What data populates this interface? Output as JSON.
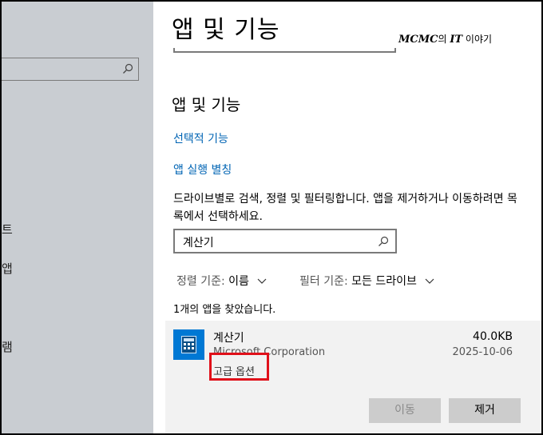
{
  "sidebar": {
    "partial_chars": [
      "트",
      "앱",
      "램"
    ]
  },
  "header": {
    "page_title": "앱 및 기능"
  },
  "watermark": {
    "brand": "MCMC",
    "mid": "의 ",
    "it": "IT",
    "suffix": " 이야기"
  },
  "section": {
    "title": "앱 및 기능",
    "links": {
      "optional_features": "선택적 기능",
      "app_aliases": "앱 실행 별칭"
    },
    "description": "드라이브별로 검색, 정렬 및 필터링합니다. 앱을 제거하거나 이동하려면 목록에서 선택하세요."
  },
  "search": {
    "value": "계산기"
  },
  "sort": {
    "label": "정렬 기준:",
    "value": "이름"
  },
  "filter": {
    "label": "필터 기준:",
    "value": "모든 드라이브"
  },
  "result_text": "1개의 앱을 찾았습니다.",
  "app": {
    "name": "계산기",
    "publisher": "Microsoft Corporation",
    "size": "40.0KB",
    "date": "2025-10-06",
    "advanced_options": "고급 옵션",
    "move_button": "이동",
    "remove_button": "제거",
    "icon": "calculator-icon"
  },
  "colors": {
    "link": "#0064b4",
    "accent_icon_bg": "#0078d4",
    "highlight_box": "#e0101a",
    "sidebar_bg": "#c9cdd2"
  }
}
